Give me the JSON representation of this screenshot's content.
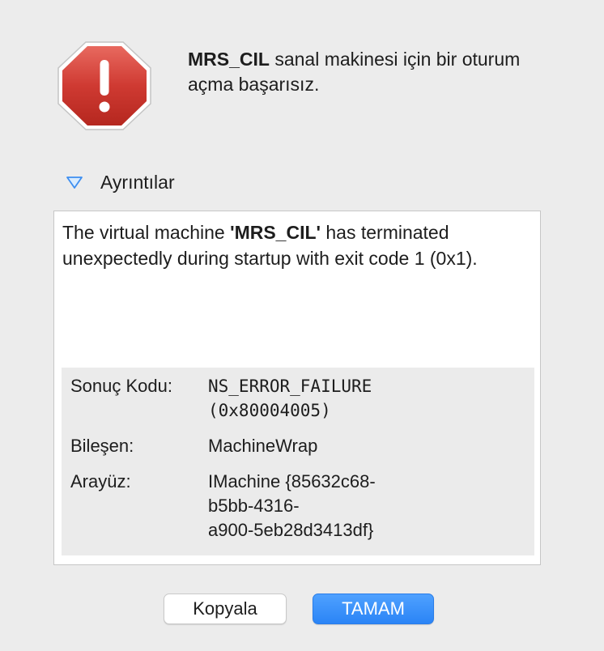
{
  "dialog": {
    "headline_bold": "MRS_CIL",
    "headline_rest": " sanal makinesi için bir oturum açma başarısız."
  },
  "details": {
    "toggle_label": "Ayrıntılar",
    "message_prefix": "The virtual machine ",
    "message_bold": "'MRS_CIL'",
    "message_suffix": " has terminated unexpectedly during startup with exit code 1 (0x1).",
    "rows": [
      {
        "key": "Sonuç Kodu:",
        "value_line1": "NS_ERROR_FAILURE",
        "value_line2": "(0x80004005)"
      },
      {
        "key": "Bileşen:",
        "value_line1": "MachineWrap"
      },
      {
        "key": "Arayüz:",
        "value_line1": "IMachine {85632c68-",
        "value_line2": "b5bb-4316-",
        "value_line3": "a900-5eb28d3413df}"
      }
    ]
  },
  "buttons": {
    "copy_label": "Kopyala",
    "ok_label": "TAMAM"
  },
  "icons": {
    "alert": "stop-sign-exclamation-icon",
    "disclosure": "disclosure-triangle-down-icon"
  },
  "colors": {
    "stop_sign": "#c9302c",
    "accent": "#2b84f6"
  }
}
